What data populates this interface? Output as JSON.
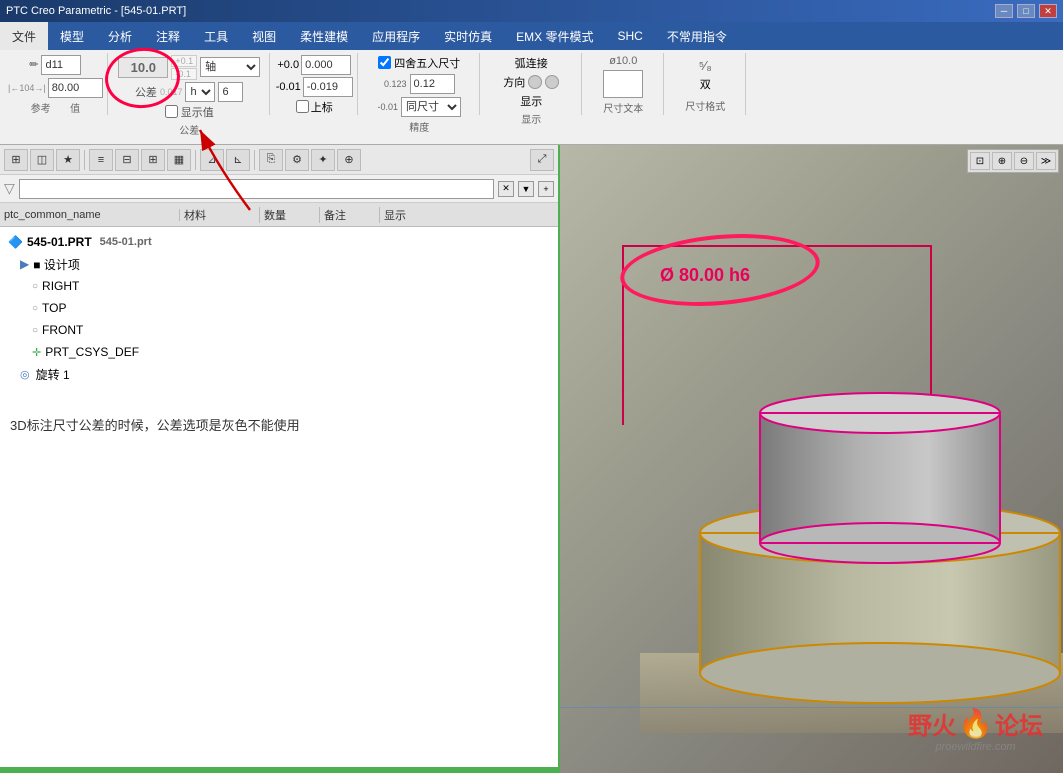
{
  "titlebar": {
    "title": "PTC Creo Parametric - [545-01.PRT]",
    "minimize": "─",
    "maximize": "□",
    "close": "✕"
  },
  "menubar": {
    "items": [
      "文件",
      "模型",
      "分析",
      "注释",
      "工具",
      "视图",
      "柔性建模",
      "应用程序",
      "实时仿真",
      "EMX 零件模式",
      "SHC",
      "不常用指令"
    ]
  },
  "ribbon": {
    "dimension_name": "d11",
    "value": "80.00",
    "value_field": "10.0",
    "axis_label": "轴",
    "h_label": "h",
    "num_6": "6",
    "ref_label": "参考",
    "value_label": "值",
    "tolerance_label": "公差",
    "precision_label": "精度",
    "display_label": "显示",
    "dim_text_label": "尺寸文本",
    "dim_format_label": "尺寸格式",
    "show_value": "显示值",
    "upper_mark": "上标",
    "four_five": "四舍五入尺寸",
    "tolerance_upper": "+0.1",
    "tolerance_lower": "-0.1",
    "tolerance_val": "0.017",
    "tolerance_neg": "-0.019",
    "precision_val": "0.12",
    "same_dim": "同尺寸",
    "arc_connect": "弧连接",
    "direction": "方向",
    "dim_val": "0.000",
    "dim_neg": "-0.019",
    "diameter_val": "ø10.0",
    "fraction_val": "5/8",
    "double_label": "双"
  },
  "left_panel": {
    "filter_placeholder": "",
    "columns": {
      "name": "ptc_common_name",
      "material": "材料",
      "quantity": "数量",
      "note": "备注",
      "display": "显示"
    },
    "tree_items": [
      {
        "id": "root",
        "label": "545-01.PRT",
        "value": "545-01.prt",
        "indent": 0,
        "icon": "📄",
        "bold": true
      },
      {
        "id": "design",
        "label": "■ 设计项",
        "indent": 1,
        "icon": ""
      },
      {
        "id": "right",
        "label": "RIGHT",
        "indent": 2,
        "icon": "○"
      },
      {
        "id": "top",
        "label": "TOP",
        "indent": 2,
        "icon": "○"
      },
      {
        "id": "front",
        "label": "FRONT",
        "indent": 2,
        "icon": "○"
      },
      {
        "id": "prt_csys",
        "label": "PRT_CSYS_DEF",
        "indent": 2,
        "icon": "✛"
      },
      {
        "id": "revolve",
        "label": "旋转 1",
        "indent": 2,
        "icon": "◎"
      }
    ]
  },
  "annotation_text": "3D标注尺寸公差的时候，公差选项是灰色不能使用",
  "dimension_label": "Ø 80.00 h6",
  "watermark": {
    "chinese": "野火",
    "flame": "🔥",
    "forum": "论坛",
    "english": "proewildfire.com"
  }
}
